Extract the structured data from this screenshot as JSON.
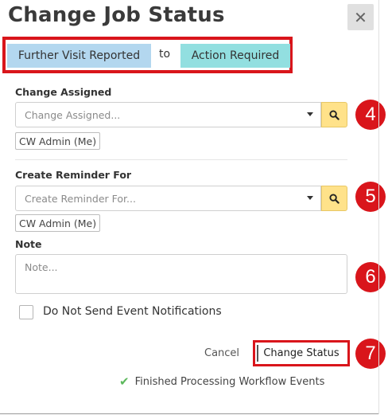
{
  "dialog": {
    "title": "Change Job Status",
    "close_glyph": "✕"
  },
  "status": {
    "from": "Further Visit Reported",
    "connector": "to",
    "to": "Action Required"
  },
  "assigned": {
    "label": "Change Assigned",
    "placeholder": "Change Assigned...",
    "chip": "CW Admin (Me)",
    "marker": "4"
  },
  "reminder": {
    "label": "Create Reminder For",
    "placeholder": "Create Reminder For...",
    "chip": "CW Admin (Me)",
    "marker": "5"
  },
  "note": {
    "label": "Note",
    "placeholder": "Note...",
    "marker": "6"
  },
  "notifications": {
    "label": "Do Not Send Event Notifications",
    "checked": false
  },
  "actions": {
    "cancel": "Cancel",
    "submit": "Change Status",
    "marker": "7"
  },
  "footer": {
    "message": "Finished Processing Workflow Events"
  },
  "colors": {
    "highlight_red": "#d9151b",
    "from_badge": "#b3d7ef",
    "to_badge": "#92dfe0",
    "search_button": "#ffe28a",
    "success_check": "#5cb85c"
  },
  "icons": {
    "close": "close-icon",
    "search": "search-icon",
    "dropdown": "caret-down-icon",
    "success": "check-icon"
  }
}
